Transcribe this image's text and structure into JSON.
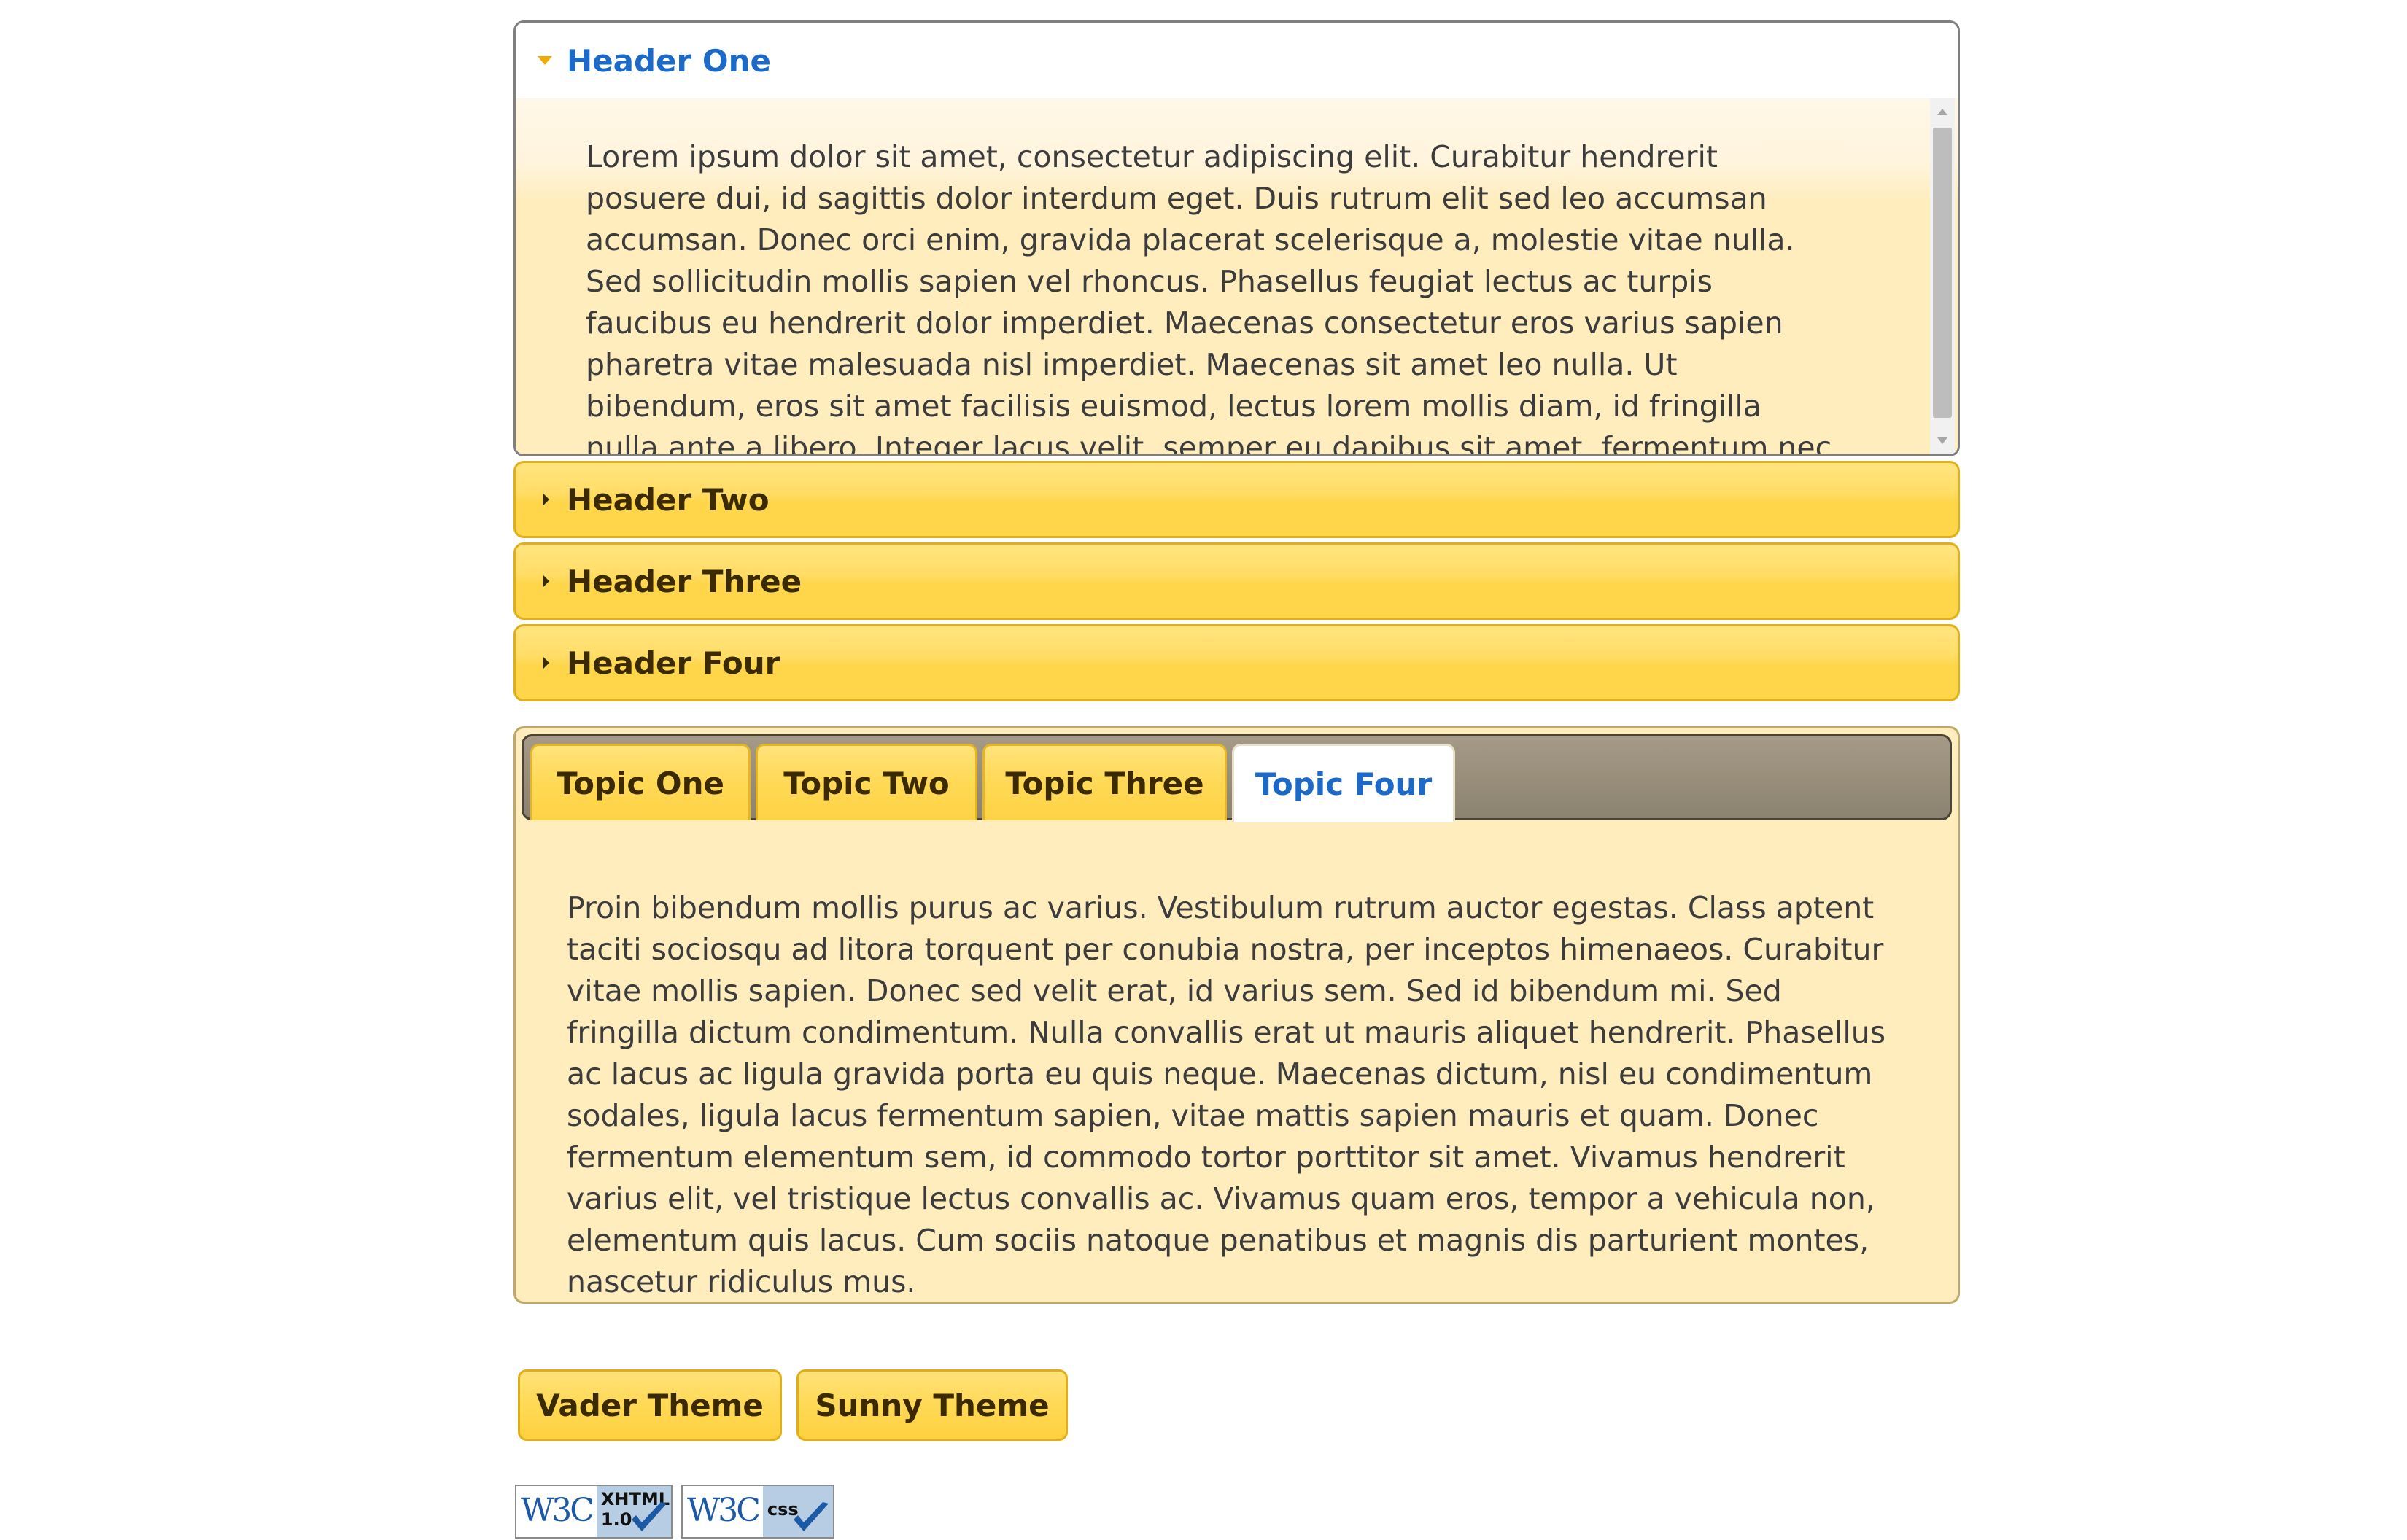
{
  "accordion": {
    "open": {
      "title": "Header One",
      "content": "Lorem ipsum dolor sit amet, consectetur adipiscing elit. Curabitur hendrerit posuere dui, id sagittis dolor interdum eget. Duis rutrum elit sed leo accumsan accumsan. Donec orci enim, gravida placerat scelerisque a, molestie vitae nulla. Sed sollicitudin mollis sapien vel rhoncus. Phasellus feugiat lectus ac turpis faucibus eu hendrerit dolor imperdiet. Maecenas consectetur eros varius sapien pharetra vitae malesuada nisl imperdiet. Maecenas sit amet leo nulla. Ut bibendum, eros sit amet facilisis euismod, lectus lorem mollis diam, id fringilla nulla ante a libero. Integer lacus velit, semper eu dapibus sit amet, fermentum nec orci."
    },
    "closed": [
      {
        "title": "Header Two"
      },
      {
        "title": "Header Three"
      },
      {
        "title": "Header Four"
      }
    ]
  },
  "tabs": {
    "items": [
      {
        "label": "Topic One"
      },
      {
        "label": "Topic Two"
      },
      {
        "label": "Topic Three"
      },
      {
        "label": "Topic Four"
      }
    ],
    "active_label": "Topic Four",
    "content": "Proin bibendum mollis purus ac varius. Vestibulum rutrum auctor egestas. Class aptent taciti sociosqu ad litora torquent per conubia nostra, per inceptos himenaeos. Curabitur vitae mollis sapien. Donec sed velit erat, id varius sem. Sed id bibendum mi. Sed fringilla dictum condimentum. Nulla convallis erat ut mauris aliquet hendrerit. Phasellus ac lacus ac ligula gravida porta eu quis neque. Maecenas dictum, nisl eu condimentum sodales, ligula lacus fermentum sapien, vitae mattis sapien mauris et quam. Donec fermentum elementum sem, id commodo tortor porttitor sit amet. Vivamus hendrerit varius elit, vel tristique lectus convallis ac. Vivamus quam eros, tempor a vehicula non, elementum quis lacus. Cum sociis natoque penatibus et magnis dis parturient montes, nascetur ridiculus mus."
  },
  "buttons": {
    "vader": "Vader Theme",
    "sunny": "Sunny Theme"
  },
  "badges": {
    "xhtml": {
      "logo": "W3C",
      "label": "XHTML\n1.0"
    },
    "css": {
      "logo": "W3C",
      "label": "css"
    }
  },
  "colors": {
    "active_text": "#1b6ac9",
    "header_gold": "#ffd54a",
    "content_bg": "#ffedbe",
    "tabbar_bg": "#978d79"
  }
}
